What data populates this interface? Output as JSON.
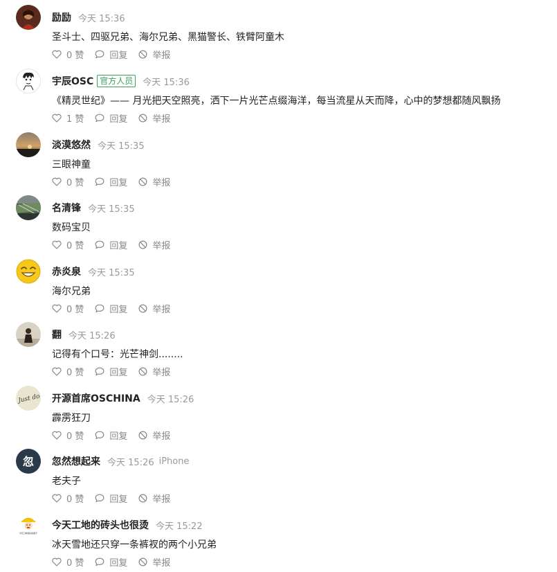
{
  "labels": {
    "like_suffix": "赞",
    "reply": "回复",
    "report": "举报"
  },
  "colors": {
    "badge_green": "#3aa05a",
    "username": "#222222",
    "meta": "#999999",
    "action": "#888888"
  },
  "comments": [
    {
      "username": "励励",
      "timestamp": "今天 15:36",
      "content": "圣斗士、四驱兄弟、海尔兄弟、黑猫警长、铁臂阿童木",
      "likes": "0 赞",
      "avatar_icon": "photo-avatar-icon"
    },
    {
      "username": "宇辰OSC",
      "badge": "官方人员",
      "timestamp": "今天 15:36",
      "content": "《精灵世纪》—— 月光把天空照亮，洒下一片光芒点缀海洋，每当流星从天而降，心中的梦想都随风飘扬",
      "likes": "1 赞",
      "avatar_icon": "cartoon-avatar-icon"
    },
    {
      "username": "淡漠悠然",
      "timestamp": "今天 15:35",
      "content": "三眼神童",
      "likes": "0 赞",
      "avatar_icon": "sunset-avatar-icon"
    },
    {
      "username": "名清锋",
      "timestamp": "今天 15:35",
      "content": "数码宝贝",
      "likes": "0 赞",
      "avatar_icon": "landscape-avatar-icon"
    },
    {
      "username": "赤炎泉",
      "timestamp": "今天 15:35",
      "content": "海尔兄弟",
      "likes": "0 赞",
      "avatar_icon": "smiley-avatar-icon"
    },
    {
      "username": "翻",
      "timestamp": "今天 15:26",
      "content": "记得有个口号：光芒神剑........",
      "likes": "0 赞",
      "avatar_icon": "person-avatar-icon"
    },
    {
      "username": "开源首席OSCHINA",
      "timestamp": "今天 15:26",
      "content": "霹雳狂刀",
      "likes": "0 赞",
      "avatar_icon": "handwriting-avatar-icon",
      "avatar_text": "Just do"
    },
    {
      "username": "忽然想起来",
      "timestamp": "今天 15:26",
      "device": "iPhone",
      "content": "老夫子",
      "likes": "0 赞",
      "avatar_icon": "letter-avatar-icon",
      "avatar_text": "忽"
    },
    {
      "username": "今天工地的砖头也很烫",
      "timestamp": "今天 15:22",
      "content": "冰天雪地还只穿一条裤衩的两个小兄弟",
      "likes": "0 赞",
      "avatar_icon": "worker-avatar-icon",
      "avatar_text": "今天工地的砖头很烫手"
    }
  ]
}
